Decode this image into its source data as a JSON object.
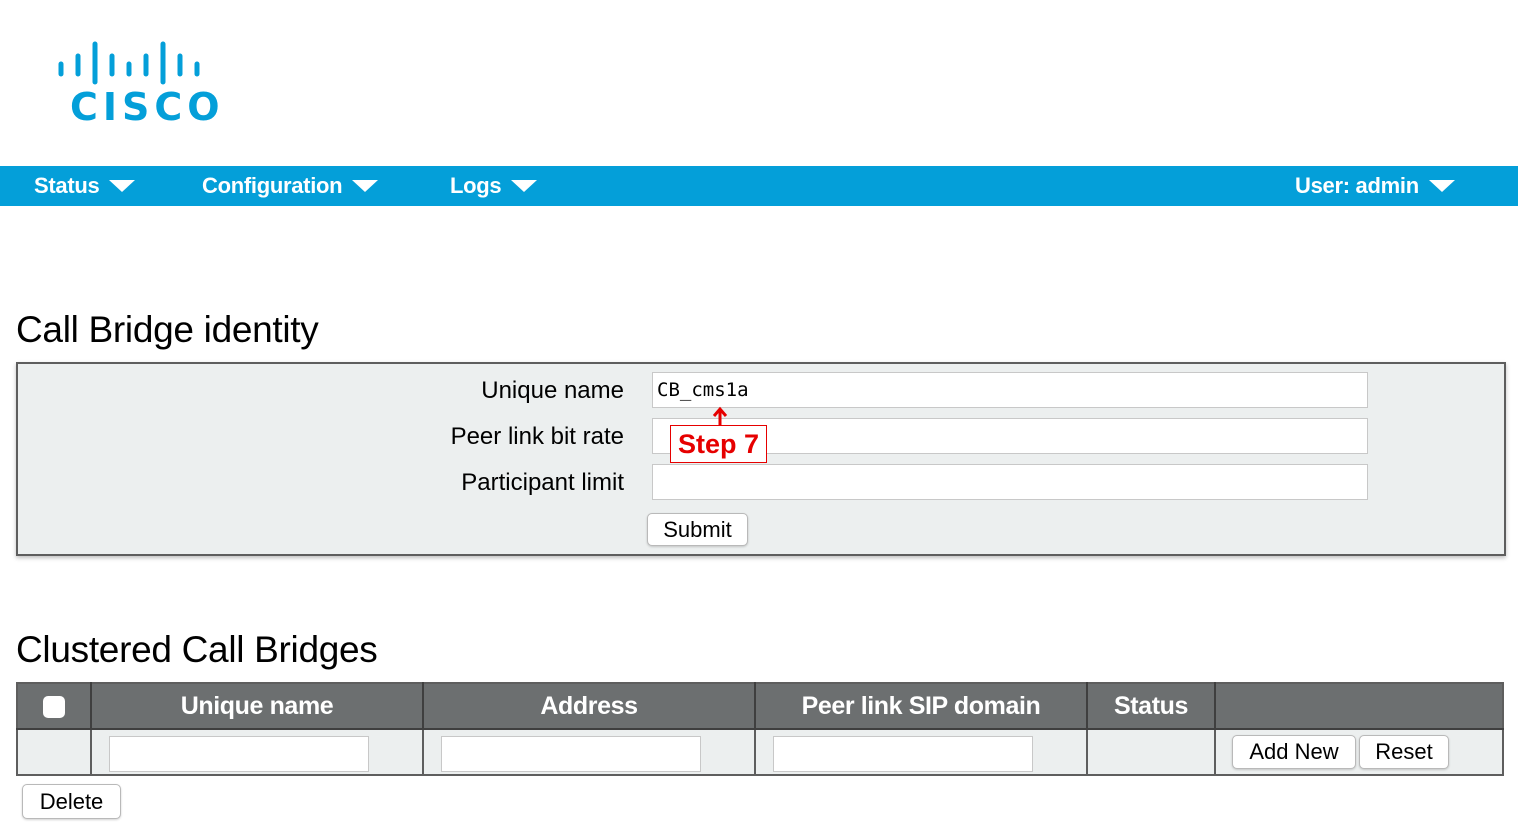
{
  "logo": {
    "text": "CISCO",
    "icon": "cisco-bars-logo",
    "color": "#049fd9"
  },
  "nav": {
    "color": "#049fd9",
    "status": "Status",
    "configuration": "Configuration",
    "logs": "Logs",
    "user": "User: admin"
  },
  "identity": {
    "title": "Call Bridge identity",
    "unique_name_label": "Unique name",
    "unique_name_value": "CB_cms1a",
    "peer_link_bit_rate_label": "Peer link bit rate",
    "peer_link_bit_rate_value": "",
    "participant_limit_label": "Participant limit",
    "participant_limit_value": "",
    "submit_label": "Submit"
  },
  "annotation": {
    "label": "Step 7",
    "color": "#e60000"
  },
  "clustered": {
    "title": "Clustered Call Bridges",
    "columns": [
      "",
      "Unique name",
      "Address",
      "Peer link SIP domain",
      "Status",
      ""
    ],
    "add_new_label": "Add New",
    "reset_label": "Reset",
    "delete_label": "Delete"
  }
}
